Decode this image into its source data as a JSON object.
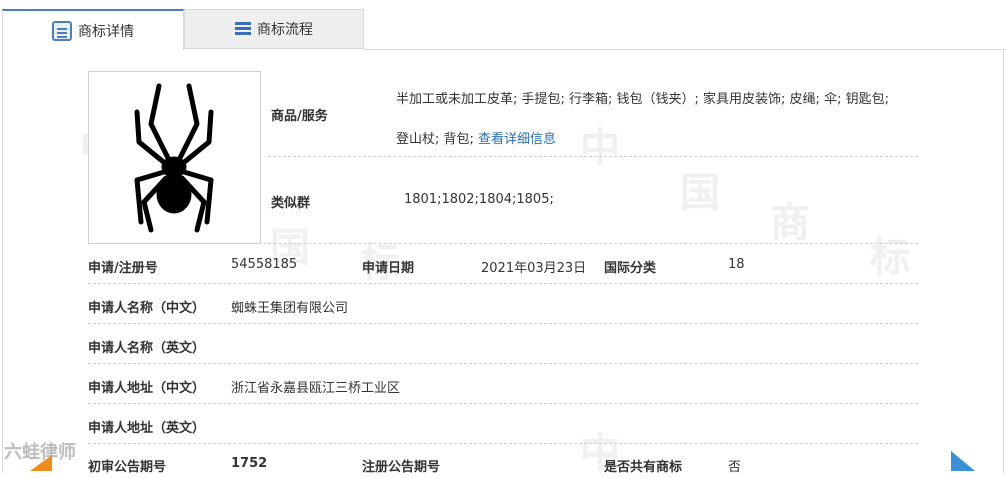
{
  "tabs": [
    {
      "label": "商标详情",
      "icon": "document-icon"
    },
    {
      "label": "商标流程",
      "icon": "list-icon"
    }
  ],
  "watermark_chars": [
    "中",
    "国",
    "商",
    "标"
  ],
  "goods_services": {
    "label": "商品/服务",
    "line1": "半加工或未加工皮革; 手提包; 行李箱; 钱包（钱夹）; 家具用皮装饰; 皮绳; 伞; 钥匙包;",
    "line2": "登山杖; 背包;",
    "more_link": "查看详细信息"
  },
  "similar_group": {
    "label": "类似群",
    "value": "1801;1802;1804;1805;"
  },
  "registration": {
    "reg_no_label": "申请/注册号",
    "reg_no": "54558185",
    "date_label": "申请日期",
    "date": "2021年03月23日",
    "class_label": "国际分类",
    "class": "18"
  },
  "applicant_cn": {
    "label": "申请人名称（中文）",
    "value": "蜘蛛王集团有限公司"
  },
  "applicant_en": {
    "label": "申请人名称（英文）",
    "value": ""
  },
  "address_cn": {
    "label": "申请人地址（中文）",
    "value": "浙江省永嘉县瓯江三桥工业区"
  },
  "address_en": {
    "label": "申请人地址（英文）",
    "value": ""
  },
  "announcement": {
    "prelim_label": "初审公告期号",
    "prelim": "1752",
    "reg_label": "注册公告期号",
    "reg": "",
    "shared_label": "是否共有商标",
    "shared": "否"
  },
  "brand_watermark": "六蛙律师",
  "colors": {
    "accent": "#4a7fc1",
    "link": "#2a6fb5",
    "arrow_left": "#f08c1a",
    "arrow_right": "#3b8fd6"
  }
}
